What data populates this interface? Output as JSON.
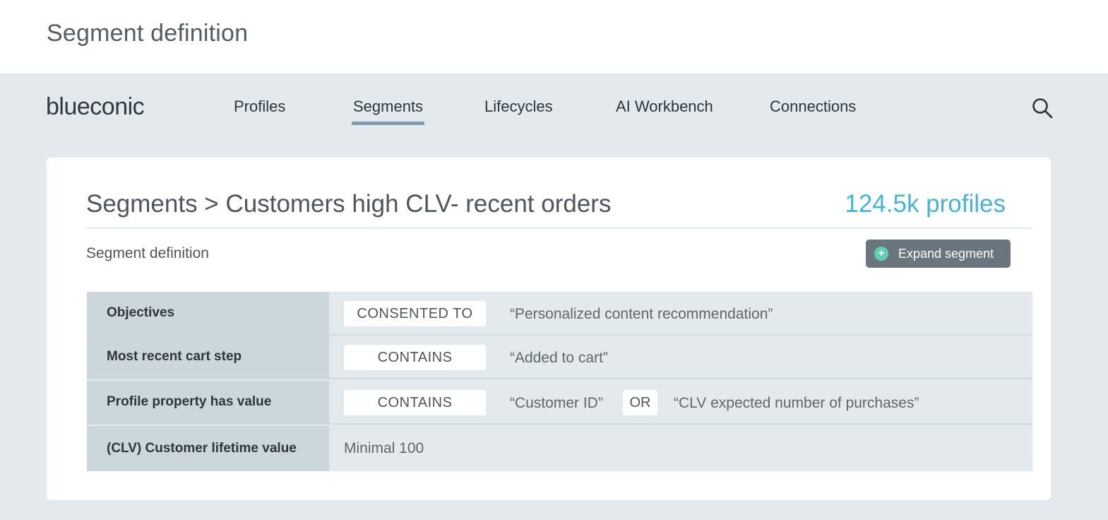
{
  "page": {
    "header_title": "Segment definition"
  },
  "nav": {
    "logo": "blueconic",
    "items": [
      {
        "label": "Profiles",
        "active": false
      },
      {
        "label": "Segments",
        "active": true
      },
      {
        "label": "Lifecycles",
        "active": false
      },
      {
        "label": "AI Workbench",
        "active": false
      },
      {
        "label": "Connections",
        "active": false
      }
    ],
    "search_icon": "search-icon",
    "active_underline_color": "#7d9cae"
  },
  "card": {
    "breadcrumb": "Segments > Customers high CLV- recent orders",
    "profile_count": "124.5k profiles",
    "profile_count_color": "#47b3d8",
    "section_label": "Segment definition",
    "expand_button": {
      "label": "Expand segment",
      "icon": "plus-circle-icon",
      "icon_color": "#5fd0b2"
    }
  },
  "rules": [
    {
      "label": "Objectives",
      "operator": "CONSENTED TO",
      "value": "“Personalized content recommendation”"
    },
    {
      "label": "Most recent cart step",
      "operator": "CONTAINS",
      "value": "“Added to cart”"
    },
    {
      "label": "Profile property has value",
      "operator": "CONTAINS",
      "value": "“Customer ID”",
      "joiner": "OR",
      "value2": "“CLV expected number of purchases”"
    },
    {
      "label": "(CLV) Customer lifetime value",
      "value": "Minimal 100"
    }
  ]
}
